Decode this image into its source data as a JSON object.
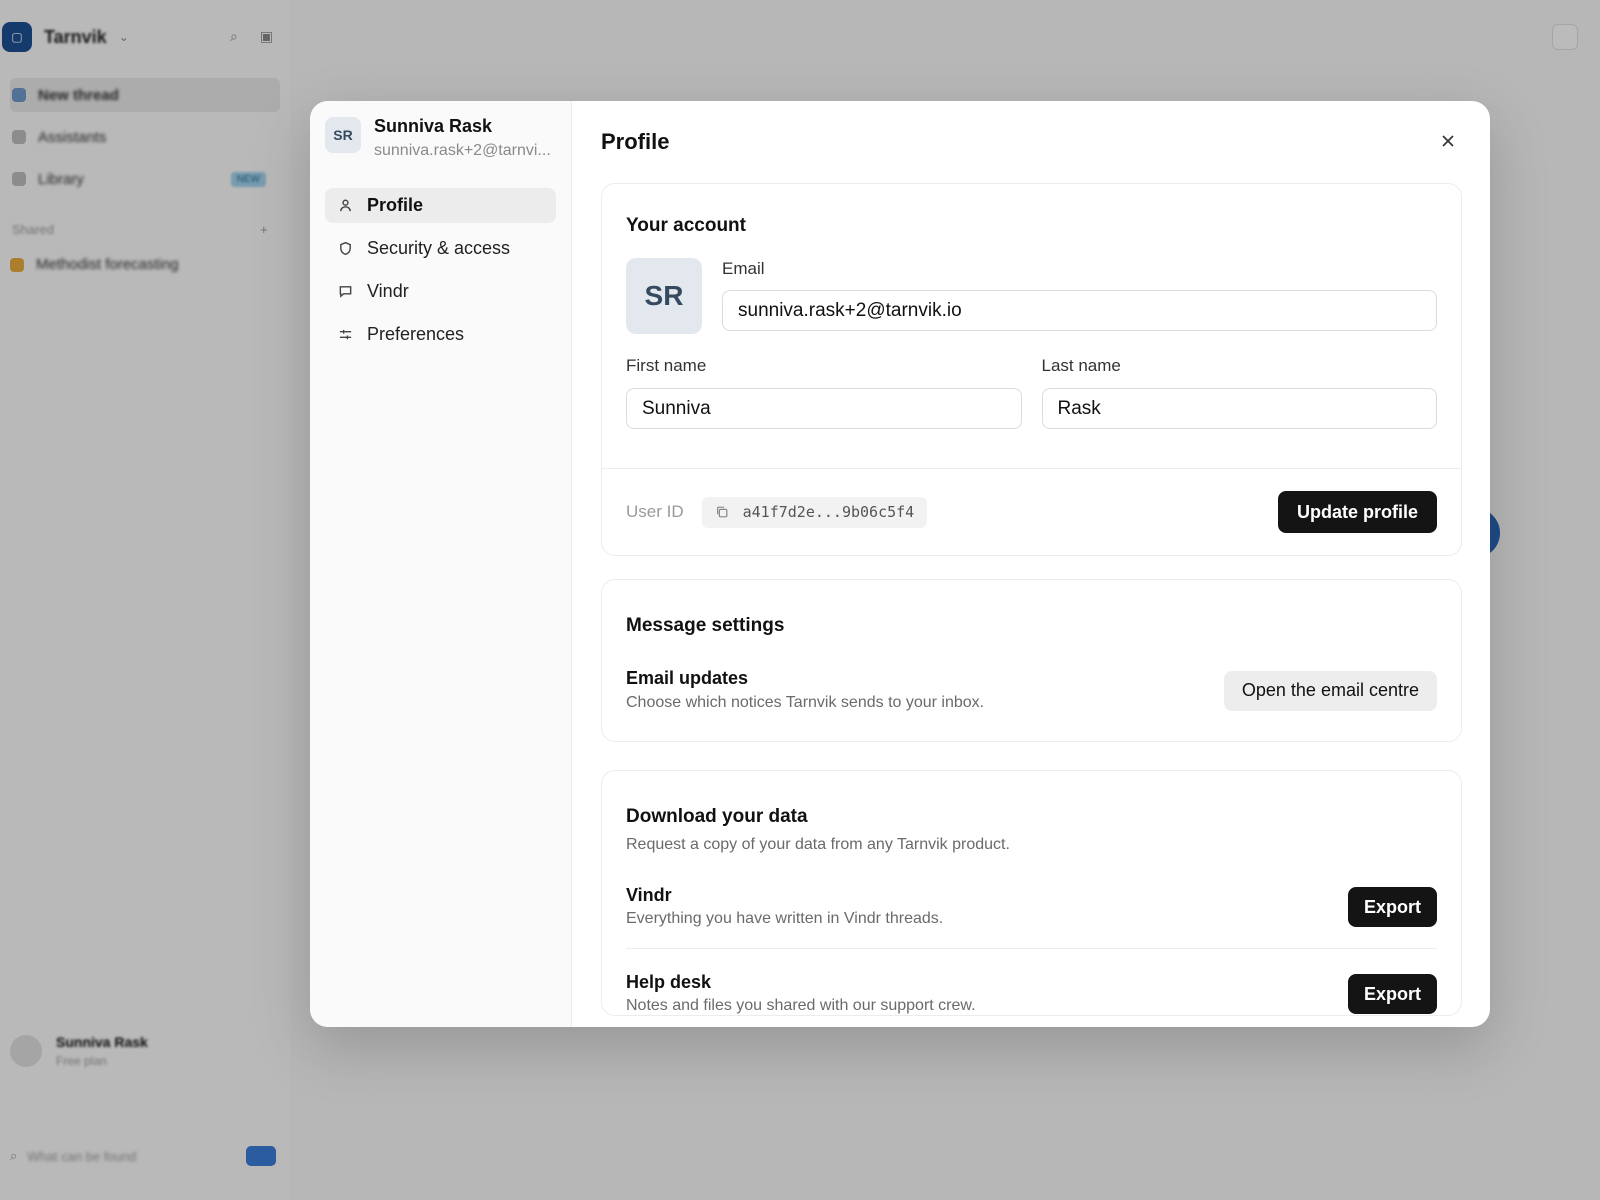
{
  "background": {
    "brand": "Tarnvik",
    "nav": [
      "New thread",
      "Assistants",
      "Library"
    ],
    "library_badge": "NEW",
    "section": "Shared",
    "project": "Methodist forecasting",
    "user_name": "Sunniva Rask",
    "user_sub": "Free plan",
    "search_placeholder": "What can be found"
  },
  "modal": {
    "user": {
      "initials": "SR",
      "name": "Sunniva Rask",
      "email_truncated": "sunniva.rask+2@tarnvi..."
    },
    "nav": [
      {
        "label": "Profile",
        "icon": "person-icon",
        "active": true
      },
      {
        "label": "Security & access",
        "icon": "shield-icon",
        "active": false
      },
      {
        "label": "Vindr",
        "icon": "chat-bubble-icon",
        "active": false
      },
      {
        "label": "Preferences",
        "icon": "sliders-icon",
        "active": false
      }
    ],
    "title": "Profile",
    "account": {
      "title": "Your account",
      "avatar_initials": "SR",
      "email_label": "Email",
      "email_value": "sunniva.rask+2@tarnvik.io",
      "first_name_label": "First name",
      "first_name_value": "Sunniva",
      "last_name_label": "Last name",
      "last_name_value": "Rask",
      "user_id_label": "User ID",
      "user_id_value": "a41f7d2e...9b06c5f4",
      "update_button": "Update profile"
    },
    "messages": {
      "title": "Message settings",
      "row_title": "Email updates",
      "row_desc": "Choose which notices Tarnvik sends to your inbox.",
      "button": "Open the email centre"
    },
    "download": {
      "title": "Download your data",
      "desc": "Request a copy of your data from any Tarnvik product.",
      "items": [
        {
          "title": "Vindr",
          "desc": "Everything you have written in Vindr threads.",
          "button": "Export"
        },
        {
          "title": "Help desk",
          "desc": "Notes and files you shared with our support crew.",
          "button": "Export"
        }
      ]
    }
  },
  "colors": {
    "overlay": "#00000040",
    "primary_button": "#141414",
    "avatar_bg": "#e3e8ee",
    "accent_blue": "#2b64b6"
  }
}
